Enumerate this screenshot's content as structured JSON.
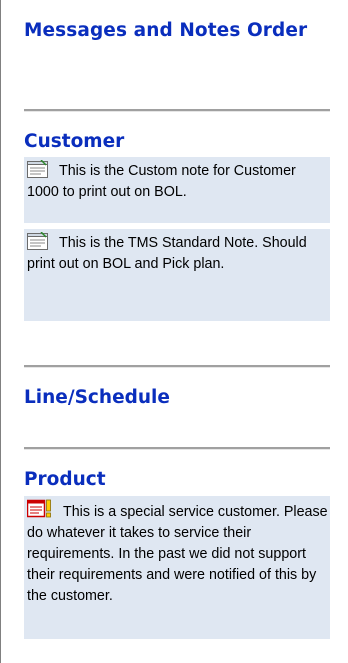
{
  "panel": {
    "title": "Messages and Notes Order"
  },
  "sections": {
    "customer": {
      "title": "Customer",
      "notes": [
        {
          "icon": "standard-note-icon",
          "text": "This is the Custom note for Customer 1000 to print out on BOL."
        },
        {
          "icon": "standard-note-icon",
          "text": "This is the TMS Standard Note. Should print out on BOL and Pick plan."
        }
      ]
    },
    "line_schedule": {
      "title": "Line/Schedule"
    },
    "product": {
      "title": "Product",
      "notes": [
        {
          "icon": "important-note-icon",
          "text": "This is a special service customer. Please do whatever it takes to service their requirements. In the past we did not support their requirements and were notified of this by the customer."
        }
      ]
    }
  },
  "colors": {
    "heading": "#0a2ebd",
    "note_background": "#dfe7f2",
    "divider": "#a0a0a0",
    "important_icon": "#cc0000",
    "important_flag": "#ffcc00"
  }
}
